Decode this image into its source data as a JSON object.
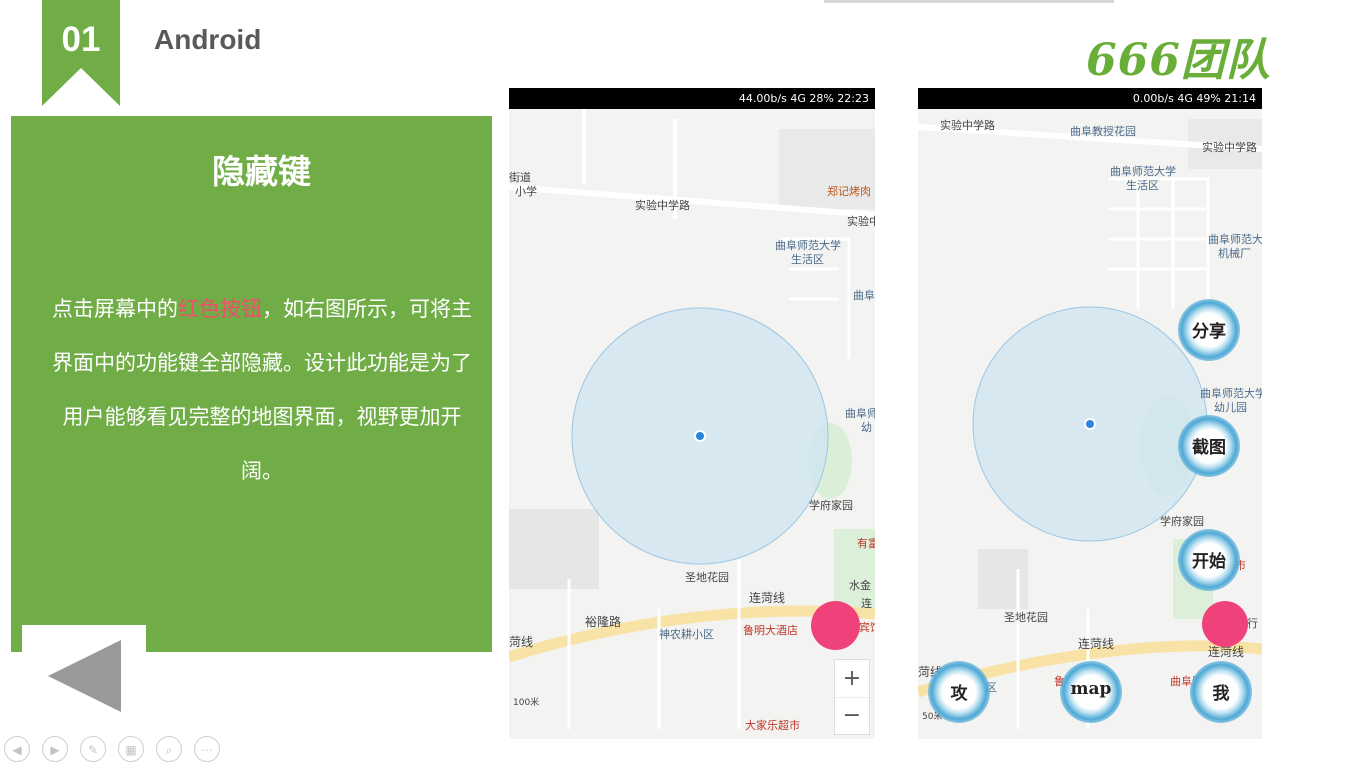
{
  "header": {
    "number": "01",
    "title": "Android",
    "logo": "666团队"
  },
  "panel": {
    "title": "隐藏键",
    "body_before": "点击屏幕中的",
    "body_highlight": "红色按钮",
    "body_after": "，如右图所示，可将主界面中的功能键全部隐藏。设计此功能是为了用户能够看见完整的地图界面，视野更加开阔。"
  },
  "phone1": {
    "status": "44.00b/s  4G 28%  22:23",
    "labels": [
      "实验中学路",
      "街道",
      "小学",
      "郑记烤肉",
      "实验中",
      "曲阜师范大学",
      "生活区",
      "曲阜",
      "曲阜师",
      "幼",
      "学府家园",
      "有富",
      "水金",
      "圣地花园",
      "连菏线",
      "连",
      "裕隆路",
      "神农耕小区",
      "鲁明大酒店",
      "宾馆",
      "菏线",
      "100米",
      "大家乐超市"
    ],
    "zoom_in": "+",
    "zoom_out": "−"
  },
  "phone2": {
    "status": "0.00b/s  4G 49%  21:14",
    "labels": [
      "实验中学路",
      "曲阜教授花园",
      "实验中学路",
      "曲阜师范大学",
      "生活区",
      "曲阜师范大",
      "机械厂",
      "曲阜师范大学",
      "幼儿园",
      "学府家园",
      "超市",
      "圣地花园",
      "连菏线",
      "连菏线",
      "商行",
      "菏线",
      "耕小区",
      "鲁明大酒店",
      "曲阜服务",
      "50米"
    ],
    "buttons": [
      "分享",
      "截图",
      "开始",
      "攻",
      "map",
      "我"
    ]
  },
  "colors": {
    "green": "#70ad47",
    "highlight": "#ef4f6a",
    "fab": "#f0427a"
  }
}
